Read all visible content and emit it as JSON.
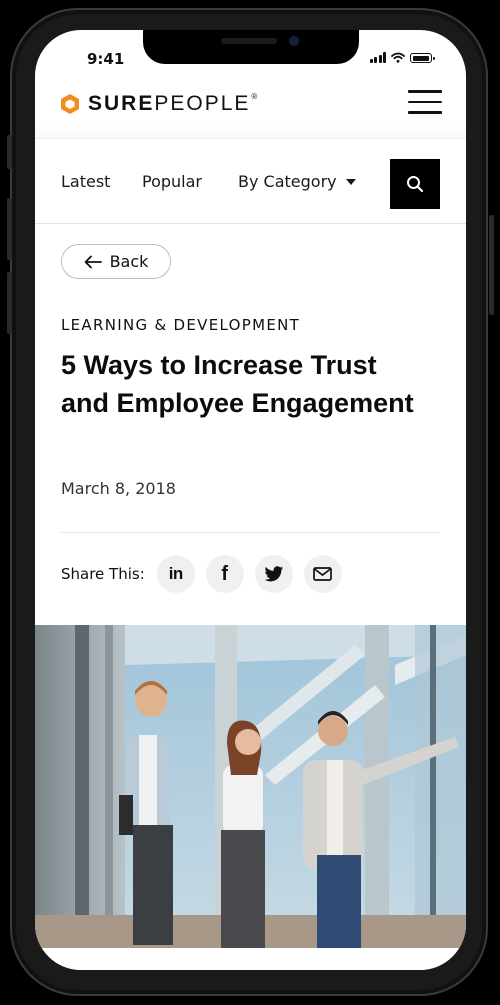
{
  "status_bar": {
    "time": "9:41"
  },
  "header": {
    "logo_bold": "SURE",
    "logo_light": "PEOPLE",
    "logo_mark": "®",
    "brand_color": "#F28C1F",
    "menu_icon": "hamburger-menu-icon"
  },
  "nav": {
    "items": [
      {
        "label": "Latest"
      },
      {
        "label": "Popular"
      },
      {
        "label": "By Category"
      }
    ],
    "search_icon": "search-icon"
  },
  "article": {
    "back_label": "Back",
    "category": "LEARNING & DEVELOPMENT",
    "title": "5 Ways to Increase Trust and Employee Engagement",
    "date": "March 8, 2018",
    "share_label": "Share This:",
    "share_icons": [
      "linkedin-icon",
      "facebook-icon",
      "twitter-icon",
      "email-icon"
    ]
  }
}
